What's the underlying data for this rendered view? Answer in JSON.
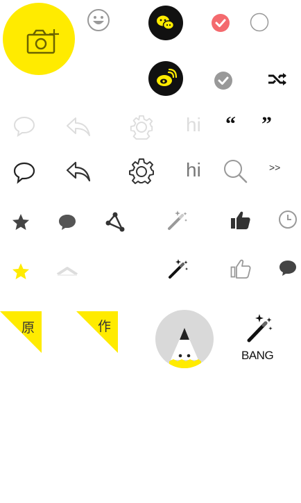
{
  "labels": {
    "hi_light": "hi",
    "hi_dark": "hi",
    "open_quote": "“",
    "close_quote": "”",
    "double_chevron": ">>",
    "original_badge": "原",
    "work_badge": "作",
    "bang_label": "BANG"
  },
  "icons": [
    "camera-add-icon",
    "smile-icon",
    "wechat-icon",
    "checked-circle-icon",
    "unchecked-circle-icon",
    "weibo-icon",
    "check-gray-icon",
    "shuffle-icon",
    "comment-outline-icon",
    "reply-icon",
    "settings-icon",
    "search-icon",
    "star-icon",
    "chat-bubble-icon",
    "share-icon",
    "magic-wand-icon",
    "thumbs-up-icon",
    "clock-icon",
    "chevron-up-icon",
    "pencil-avatar-icon"
  ],
  "colors": {
    "yellow": "#FFEB00",
    "black": "#111111",
    "red_check": "#F46A6E",
    "gray": "#999999",
    "dark_gray": "#555555",
    "light_gray": "#DDDDDD",
    "avatar_bg": "#D9D9D9"
  }
}
